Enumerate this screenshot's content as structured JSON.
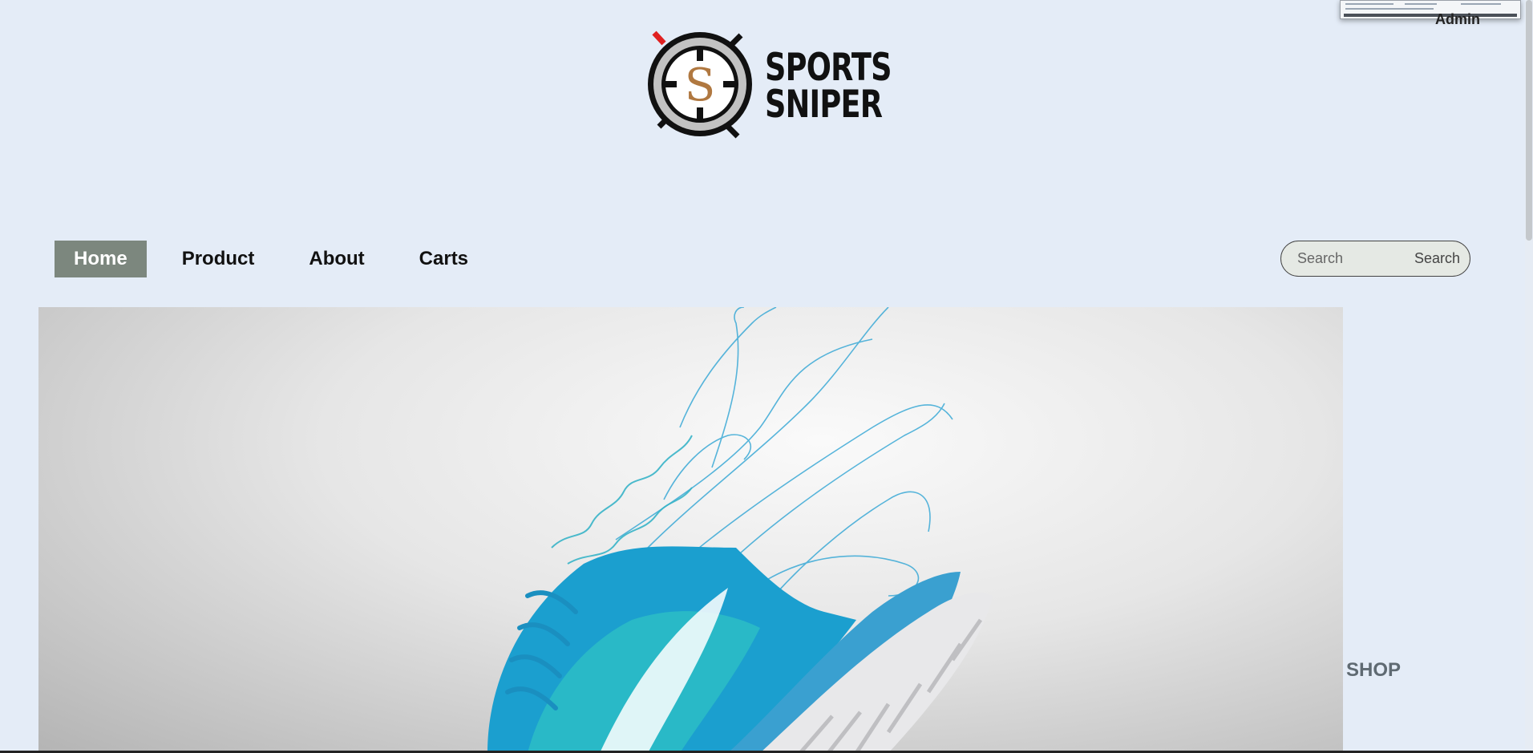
{
  "header": {
    "admin_label": "Admin",
    "brand": {
      "line1": "SPORTS",
      "line2": "SNIPER",
      "monogram": "S"
    }
  },
  "nav": {
    "items": [
      {
        "label": "Home",
        "active": true
      },
      {
        "label": "Product",
        "active": false
      },
      {
        "label": "About",
        "active": false
      },
      {
        "label": "Carts",
        "active": false
      }
    ]
  },
  "search": {
    "placeholder": "Search",
    "button_label": "Search"
  },
  "hero": {
    "subject": "sneaker-hero-image"
  },
  "side": {
    "shop_label": "SHOP"
  },
  "colors": {
    "page_bg": "#e4ecf7",
    "nav_active_bg": "#7c877e",
    "logo_gold": "#b07840",
    "logo_red": "#e02020"
  }
}
